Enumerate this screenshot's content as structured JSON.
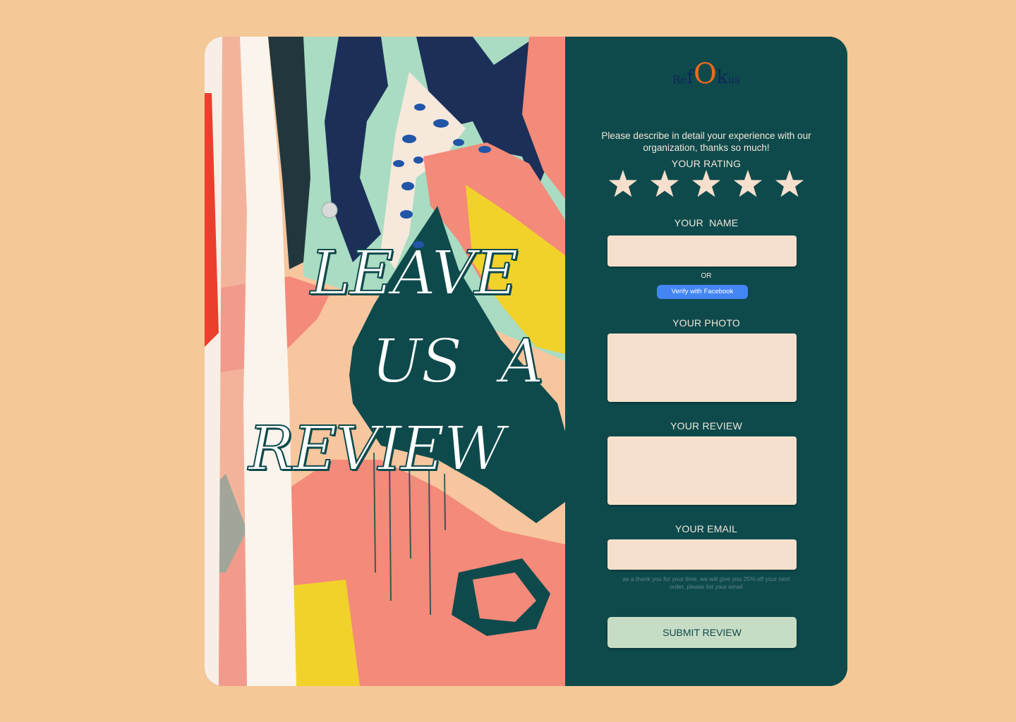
{
  "hero": {
    "line1": "LEAVE",
    "line2": "US  A",
    "line3": "REVIEW"
  },
  "brand": {
    "logo_parts": [
      "Re",
      "f",
      "O",
      "k",
      "us"
    ]
  },
  "form": {
    "intro": "Please describe in detail your experience with our organization, thanks so much!",
    "rating_label": "YOUR RATING",
    "rating_stars": 5,
    "name_label": "YOUR  NAME",
    "name_value": "",
    "or_text": "OR",
    "facebook_button": "Verify with Facebook",
    "photo_label": "YOUR PHOTO",
    "review_label": "YOUR REVIEW",
    "review_value": "",
    "email_label": "YOUR EMAIL",
    "email_value": "",
    "email_note": "as a thank you for your time, we will give you 25% off your next order, please list your email",
    "submit_label": "SUBMIT REVIEW"
  },
  "colors": {
    "page_background": "#f5c897",
    "panel": "#0e4a4c",
    "field": "#f6e0cd",
    "star": "#f6e0cd",
    "submit": "#c7dcc4",
    "facebook": "#4485f4",
    "logo_accent": "#f26a1b",
    "logo_text": "#12235c"
  }
}
